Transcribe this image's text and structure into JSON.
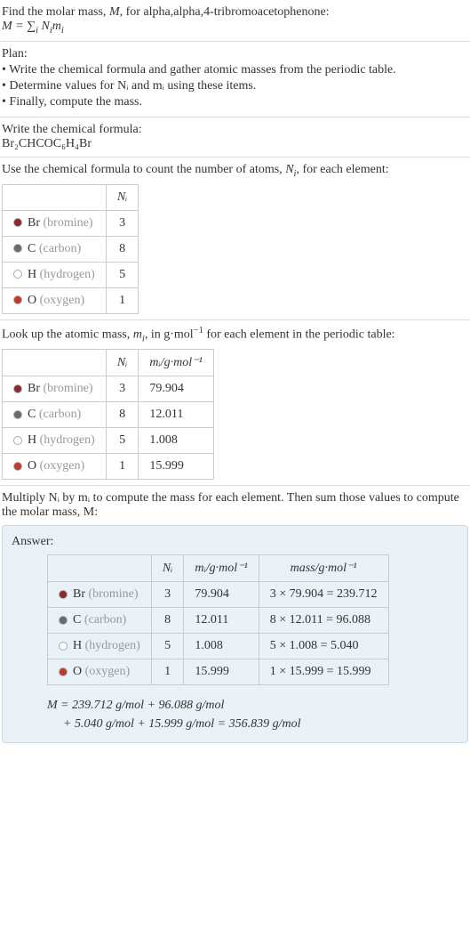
{
  "intro": {
    "line1_pre": "Find the molar mass, ",
    "line1_M": "M",
    "line1_mid": ", for alpha,alpha,4-tribromoacetophenone:",
    "eqn_html": "M = ∑",
    "eqn_sub": "i",
    "eqn_rest": " N",
    "eqn_i1": "i",
    "eqn_m": "m",
    "eqn_i2": "i"
  },
  "plan": {
    "header": "Plan:",
    "items": [
      "• Write the chemical formula and gather atomic masses from the periodic table.",
      "• Determine values for Nᵢ and mᵢ using these items.",
      "• Finally, compute the mass."
    ]
  },
  "chemformula": {
    "header": "Write the chemical formula:",
    "formula": "Br₂CHCOC₆H₄Br"
  },
  "count": {
    "header_pre": "Use the chemical formula to count the number of atoms, ",
    "header_Ni": "N",
    "header_i": "i",
    "header_post": ", for each element:",
    "col_ni": "Nᵢ",
    "rows": [
      {
        "color": "#8a2a2a",
        "sym": "Br",
        "name": "(bromine)",
        "ni": "3"
      },
      {
        "color": "#6b6b6b",
        "sym": "C",
        "name": "(carbon)",
        "ni": "8"
      },
      {
        "color": "#ffffff",
        "sym": "H",
        "name": "(hydrogen)",
        "ni": "5"
      },
      {
        "color": "#c0392b",
        "sym": "O",
        "name": "(oxygen)",
        "ni": "1"
      }
    ]
  },
  "atomic": {
    "header_pre": "Look up the atomic mass, ",
    "header_mi": "m",
    "header_i": "i",
    "header_mid": ", in g·mol",
    "header_exp": "−1",
    "header_post": " for each element in the periodic table:",
    "col_ni": "Nᵢ",
    "col_mi": "mᵢ/g·mol⁻¹",
    "rows": [
      {
        "color": "#8a2a2a",
        "sym": "Br",
        "name": "(bromine)",
        "ni": "3",
        "mi": "79.904"
      },
      {
        "color": "#6b6b6b",
        "sym": "C",
        "name": "(carbon)",
        "ni": "8",
        "mi": "12.011"
      },
      {
        "color": "#ffffff",
        "sym": "H",
        "name": "(hydrogen)",
        "ni": "5",
        "mi": "1.008"
      },
      {
        "color": "#c0392b",
        "sym": "O",
        "name": "(oxygen)",
        "ni": "1",
        "mi": "15.999"
      }
    ]
  },
  "multiply": {
    "text": "Multiply Nᵢ by mᵢ to compute the mass for each element. Then sum those values to compute the molar mass, M:"
  },
  "answer": {
    "label": "Answer:",
    "col_ni": "Nᵢ",
    "col_mi": "mᵢ/g·mol⁻¹",
    "col_mass": "mass/g·mol⁻¹",
    "rows": [
      {
        "color": "#8a2a2a",
        "sym": "Br",
        "name": "(bromine)",
        "ni": "3",
        "mi": "79.904",
        "mass": "3 × 79.904 = 239.712"
      },
      {
        "color": "#6b6b6b",
        "sym": "C",
        "name": "(carbon)",
        "ni": "8",
        "mi": "12.011",
        "mass": "8 × 12.011 = 96.088"
      },
      {
        "color": "#ffffff",
        "sym": "H",
        "name": "(hydrogen)",
        "ni": "5",
        "mi": "1.008",
        "mass": "5 × 1.008 = 5.040"
      },
      {
        "color": "#c0392b",
        "sym": "O",
        "name": "(oxygen)",
        "ni": "1",
        "mi": "15.999",
        "mass": "1 × 15.999 = 15.999"
      }
    ],
    "m_line1": "M = 239.712 g/mol + 96.088 g/mol",
    "m_line2": "+ 5.040 g/mol + 15.999 g/mol = 356.839 g/mol"
  }
}
